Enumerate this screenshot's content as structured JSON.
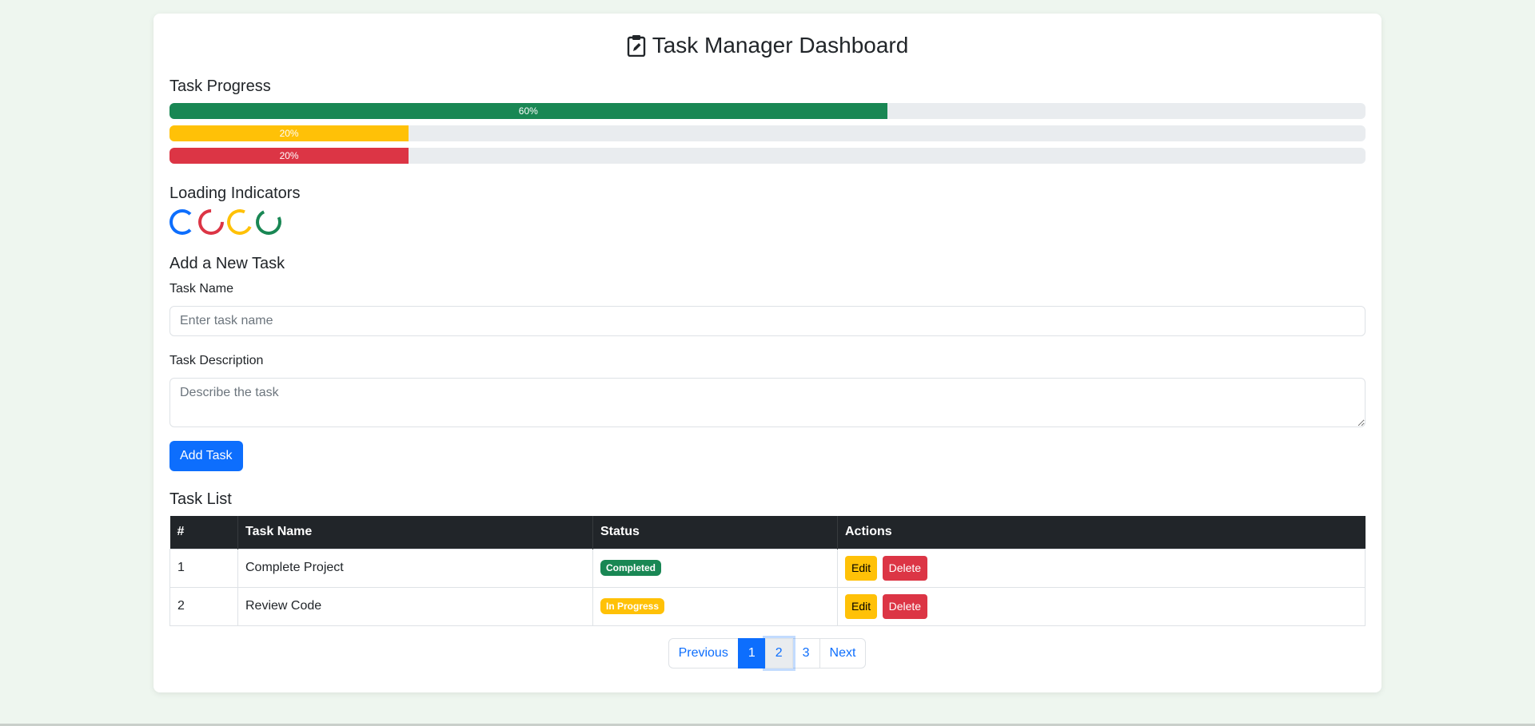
{
  "header": {
    "title": "Task Manager Dashboard",
    "icon": "clipboard-pencil-icon"
  },
  "progress": {
    "heading": "Task Progress",
    "bars": [
      {
        "label": "60%",
        "value": 0.6,
        "color": "#198754"
      },
      {
        "label": "20%",
        "value": 0.2,
        "color": "#ffc107"
      },
      {
        "label": "20%",
        "value": 0.2,
        "color": "#dc3545"
      }
    ]
  },
  "loading": {
    "heading": "Loading Indicators",
    "spinners": [
      "#0d6efd",
      "#dc3545",
      "#ffc107",
      "#198754"
    ]
  },
  "form": {
    "heading": "Add a New Task",
    "name_label": "Task Name",
    "name_placeholder": "Enter task name",
    "desc_label": "Task Description",
    "desc_placeholder": "Describe the task",
    "submit_label": "Add Task"
  },
  "tasks": {
    "heading": "Task List",
    "columns": [
      "#",
      "Task Name",
      "Status",
      "Actions"
    ],
    "rows": [
      {
        "num": "1",
        "name": "Complete Project",
        "status": "Completed",
        "status_color": "#198754",
        "edit": "Edit",
        "delete": "Delete"
      },
      {
        "num": "2",
        "name": "Review Code",
        "status": "In Progress",
        "status_color": "#ffc107",
        "edit": "Edit",
        "delete": "Delete"
      }
    ]
  },
  "pagination": {
    "previous": "Previous",
    "pages": [
      "1",
      "2",
      "3"
    ],
    "next": "Next",
    "active_page": "1"
  }
}
